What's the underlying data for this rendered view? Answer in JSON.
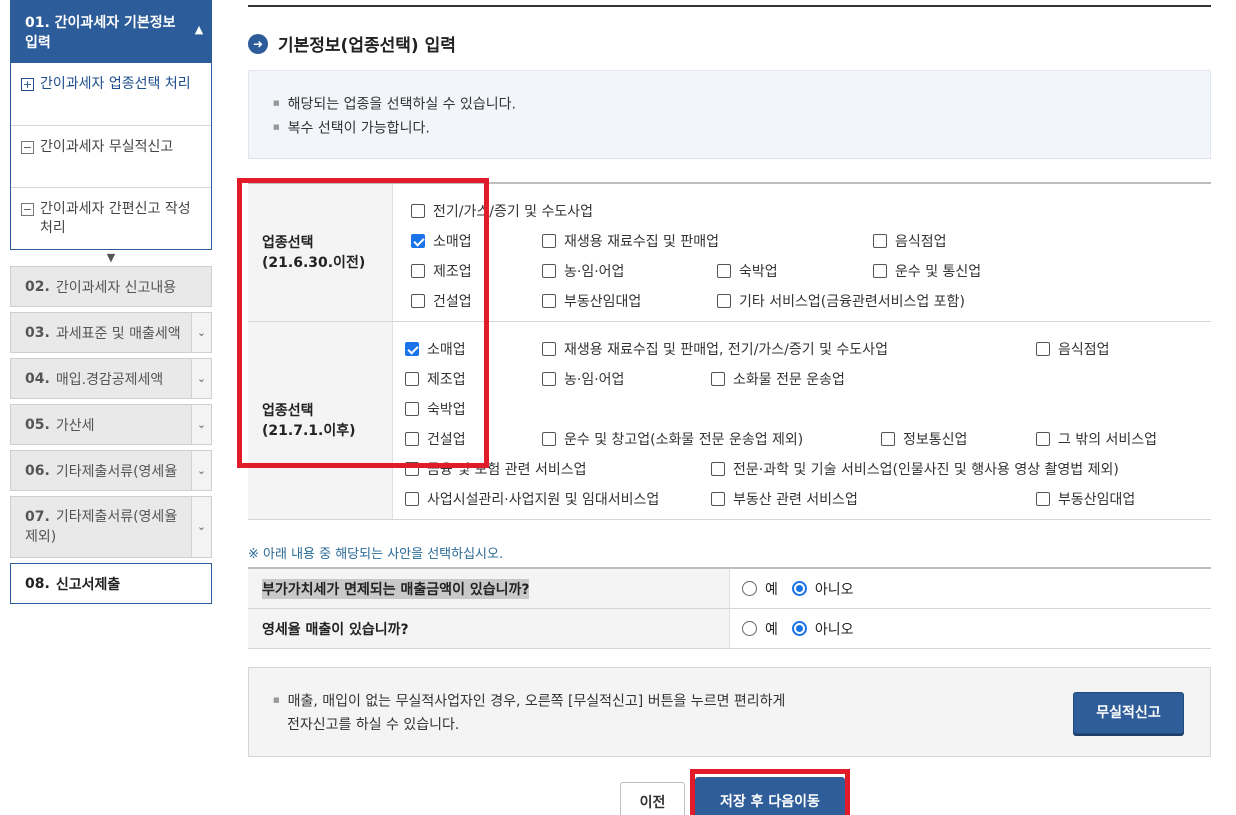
{
  "sidebar": {
    "group": {
      "title": "01. 간이과세자 기본정보 입력",
      "sub_items": [
        {
          "icon": "plus-box-icon",
          "glyph": "+",
          "label": "간이과세자 업종선택 처리"
        },
        {
          "icon": "minus-box-icon",
          "glyph": "−",
          "label": "간이과세자 무실적신고"
        },
        {
          "icon": "minus-box-icon",
          "glyph": "−",
          "label": "간이과세자 간편신고 작성 처리"
        }
      ]
    },
    "steps": [
      {
        "num": "02.",
        "label": "간이과세자 신고내용"
      },
      {
        "num": "03.",
        "label": "과세표준 및 매출세액"
      },
      {
        "num": "04.",
        "label": "매입.경감공제세액"
      },
      {
        "num": "05.",
        "label": "가산세"
      },
      {
        "num": "06.",
        "label": "기타제출서류(영세율"
      },
      {
        "num": "07.",
        "label": "기타제출서류(영세율 제외)"
      },
      {
        "num": "08.",
        "label": "신고서제출"
      }
    ]
  },
  "main": {
    "title": "기본정보(업종선택) 입력",
    "info": [
      "해당되는 업종을 선택하실 수 있습니다.",
      "복수 선택이 가능합니다."
    ],
    "section1": {
      "label_line1": "업종선택",
      "label_line2": "(21.6.30.이전)",
      "options": [
        {
          "label": "전기/가스/증기 및 수도사업",
          "checked": false
        },
        {
          "label": "소매업",
          "checked": true
        },
        {
          "label": "재생용 재료수집 및 판매업",
          "checked": false
        },
        {
          "label": "음식점업",
          "checked": false
        },
        {
          "label": "제조업",
          "checked": false
        },
        {
          "label": "농·임·어업",
          "checked": false
        },
        {
          "label": "숙박업",
          "checked": false
        },
        {
          "label": "운수 및 통신업",
          "checked": false
        },
        {
          "label": "건설업",
          "checked": false
        },
        {
          "label": "부동산임대업",
          "checked": false
        },
        {
          "label": "기타 서비스업(금융관련서비스업 포함)",
          "checked": false
        }
      ]
    },
    "section2": {
      "label_line1": "업종선택",
      "label_line2": "(21.7.1.이후)",
      "options": [
        {
          "label": "소매업",
          "checked": true
        },
        {
          "label": "재생용 재료수집 및 판매업, 전기/가스/증기 및 수도사업",
          "checked": false
        },
        {
          "label": "음식점업",
          "checked": false
        },
        {
          "label": "제조업",
          "checked": false
        },
        {
          "label": "농·임·어업",
          "checked": false
        },
        {
          "label": "소화물 전문 운송업",
          "checked": false
        },
        {
          "label": "숙박업",
          "checked": false
        },
        {
          "label": "건설업",
          "checked": false
        },
        {
          "label": "운수 및 창고업(소화물 전문 운송업 제외)",
          "checked": false
        },
        {
          "label": "정보통신업",
          "checked": false
        },
        {
          "label": "그 밖의 서비스업",
          "checked": false
        },
        {
          "label": "금융 및 보험 관련 서비스업",
          "checked": false
        },
        {
          "label": "전문·과학 및 기술 서비스업(인물사진 및 행사용 영상 촬영법 제외)",
          "checked": false
        },
        {
          "label": "사업시설관리·사업지원 및 임대서비스업",
          "checked": false
        },
        {
          "label": "부동산 관련 서비스업",
          "checked": false
        },
        {
          "label": "부동산임대업",
          "checked": false
        }
      ]
    },
    "notice": "※ 아래 내용 중 해당되는 사안을 선택하십시오.",
    "questions": [
      {
        "text": "부가가치세가 면제되는 매출금액이 있습니까?",
        "yes_label": "예",
        "no_label": "아니오",
        "selected": "아니오"
      },
      {
        "text": "영세율 매출이 있습니까?",
        "yes_label": "예",
        "no_label": "아니오",
        "selected": "아니오"
      }
    ],
    "bottom_note_line1": "매출, 매입이 없는 무실적사업자인 경우, 오른쪽 [무실적신고] 버튼을 누르면 편리하게",
    "bottom_note_line2": "전자신고를 하실 수 있습니다.",
    "nil_button": "무실적신고",
    "prev_button": "이전",
    "next_button": "저장 후 다음이동"
  },
  "colors": {
    "brand": "#2d5c9a",
    "highlight_frame": "#e21b2a",
    "checkbox_on": "#1a73e8"
  }
}
